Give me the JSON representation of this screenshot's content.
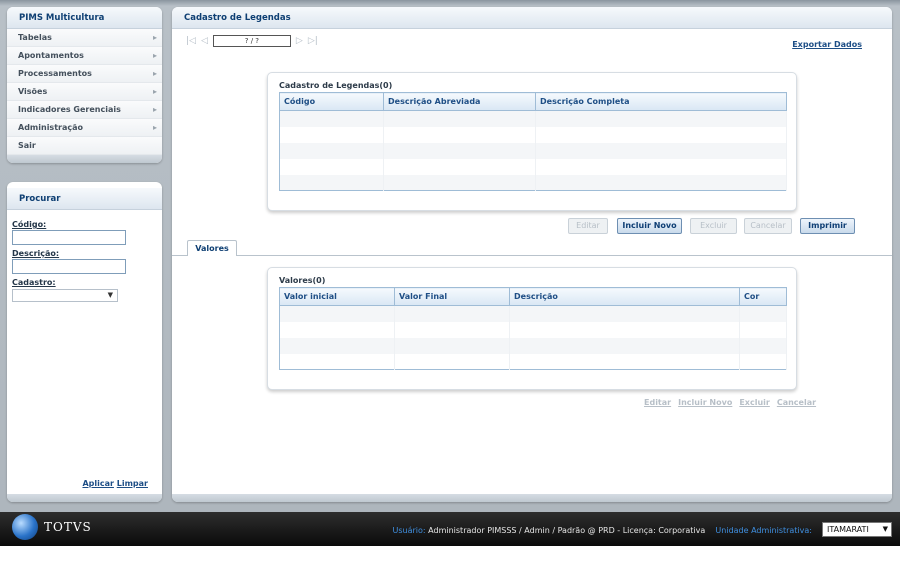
{
  "menu": {
    "title": "PIMS Multicultura",
    "items": [
      {
        "label": "Tabelas",
        "arrow": true
      },
      {
        "label": "Apontamentos",
        "arrow": true
      },
      {
        "label": "Processamentos",
        "arrow": true
      },
      {
        "label": "Visões",
        "arrow": true
      },
      {
        "label": "Indicadores Gerenciais",
        "arrow": true
      },
      {
        "label": "Administração",
        "arrow": true
      },
      {
        "label": "Sair",
        "arrow": false
      }
    ]
  },
  "search": {
    "title": "Procurar",
    "codigo_label": "Código:",
    "codigo_value": "",
    "descricao_label": "Descrição:",
    "descricao_value": "",
    "cadastro_label": "Cadastro:",
    "cadastro_value": "",
    "apply_label": "Aplicar",
    "clear_label": "Limpar"
  },
  "main": {
    "title": "Cadastro de Legendas",
    "pager_text": "? / ?",
    "export_label": "Exportar Dados"
  },
  "legendas": {
    "title": "Cadastro de Legendas(0)",
    "columns": [
      "Código",
      "Descrição Abreviada",
      "Descrição Completa"
    ],
    "rows": []
  },
  "buttons": {
    "editar": "Editar",
    "incluir": "Incluir Novo",
    "excluir": "Excluir",
    "cancelar": "Cancelar",
    "imprimir": "Imprimir"
  },
  "tab": {
    "label": "Valores"
  },
  "valores": {
    "title": "Valores(0)",
    "columns": [
      "Valor inicial",
      "Valor Final",
      "Descrição",
      "Cor"
    ],
    "rows": []
  },
  "valores_links": {
    "editar": "Editar",
    "incluir": "Incluir Novo",
    "excluir": "Excluir",
    "cancelar": "Cancelar"
  },
  "footer": {
    "brand": "TOTVS",
    "user_label": "Usuário:",
    "user_info": "Administrador PIMSSS / Admin / Padrão @ PRD - Licença: Corporativa",
    "unit_label": "Unidade Administrativa:",
    "unit_value": "ITAMARATI"
  },
  "colors": {
    "accent": "#1d4e86",
    "header_text": "#0e3f73",
    "footer_bg": "#111111",
    "footer_label": "#3f8fe0"
  },
  "icons": [
    "first-page-icon",
    "prev-page-icon",
    "next-page-icon",
    "last-page-icon",
    "chevron-right-icon",
    "dropdown-caret-icon",
    "totvs-logo-icon"
  ]
}
